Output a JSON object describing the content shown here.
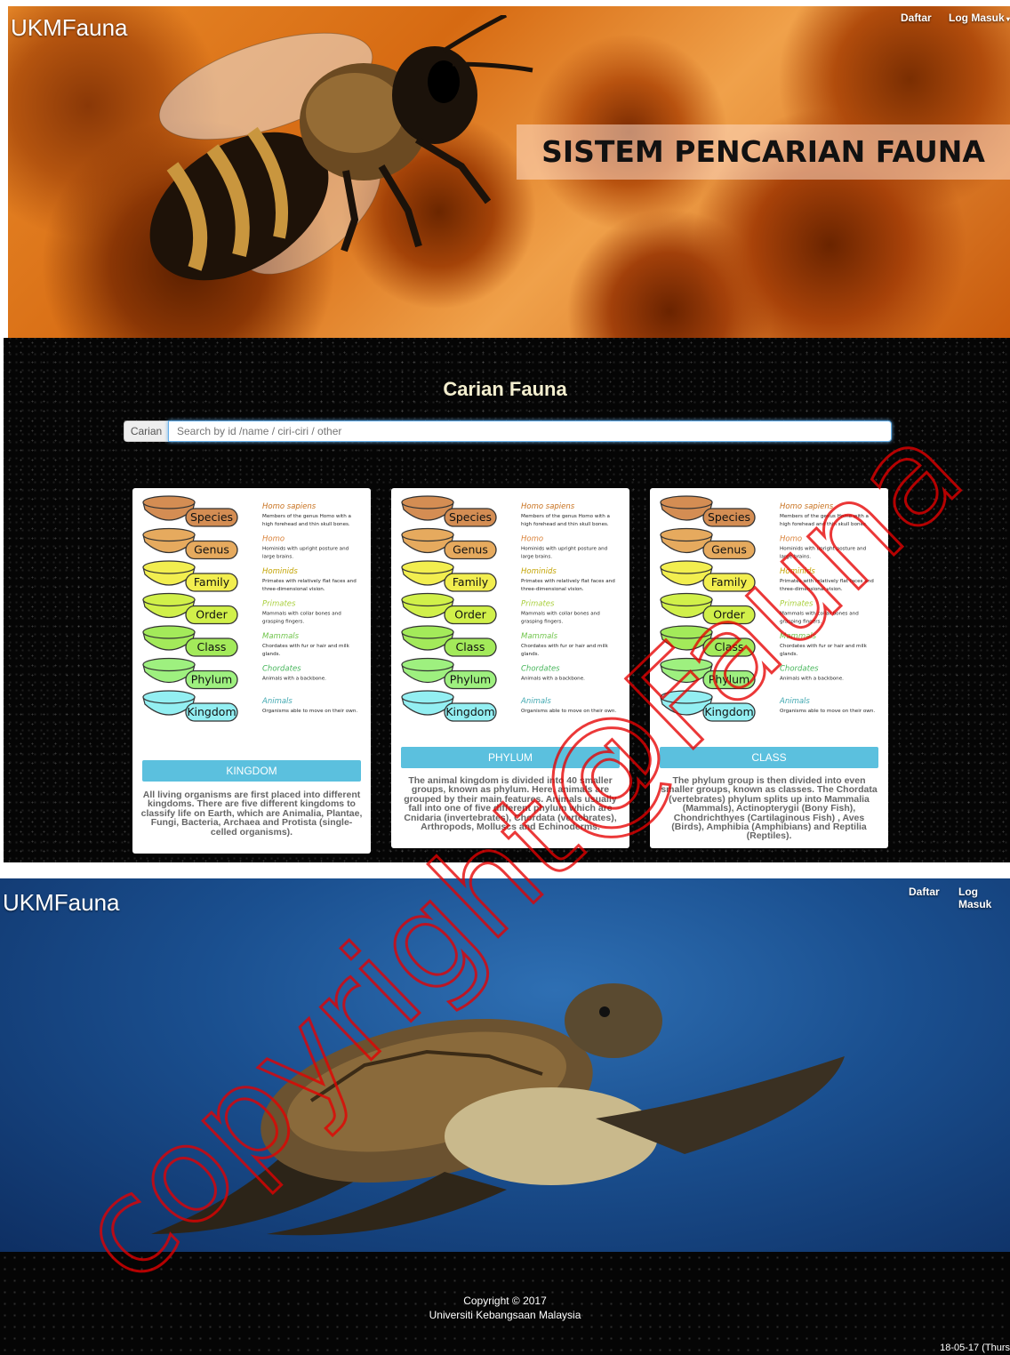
{
  "header1": {
    "brand": "UKMFauna",
    "nav_daftar": "Daftar",
    "nav_login": "Log Masuk",
    "banner": "SISTEM PENCARIAN FAUNA"
  },
  "search": {
    "title": "Carian Fauna",
    "addon": "Carian",
    "placeholder": "Search by id /name / ciri-ciri / other",
    "value": ""
  },
  "taxonomy": {
    "levels": [
      "Species",
      "Genus",
      "Family",
      "Order",
      "Class",
      "Phylum",
      "Kingdom"
    ],
    "colors": [
      "#d48d53",
      "#e6aa5e",
      "#f2ee4f",
      "#d1f04a",
      "#a3ea5a",
      "#9ef07f",
      "#93eff2"
    ],
    "examples": [
      {
        "name": "Homo sapiens",
        "desc1": "Members of the genus Homo with a",
        "desc2": "high forehead and thin skull bones.",
        "color": "#c8711e"
      },
      {
        "name": "Homo",
        "desc1": "Hominids with upright posture and",
        "desc2": "large brains.",
        "color": "#d9823a"
      },
      {
        "name": "Hominids",
        "desc1": "Primates with relatively flat faces and",
        "desc2": "three-dimensional vision.",
        "color": "#c3a300"
      },
      {
        "name": "Primates",
        "desc1": "Mammals with collar bones and",
        "desc2": "grasping fingers.",
        "color": "#a9cf3c"
      },
      {
        "name": "Mammals",
        "desc1": "Chordates with fur or hair and milk",
        "desc2": "glands.",
        "color": "#6fc44a"
      },
      {
        "name": "Chordates",
        "desc1": "Animals with a backbone.",
        "desc2": "",
        "color": "#48b65c"
      },
      {
        "name": "Animals",
        "desc1": "Organisms able to move on their own.",
        "desc2": "",
        "color": "#3fa7b0"
      }
    ]
  },
  "cards": [
    {
      "button": "KINGDOM",
      "text": "All living organisms are first placed into different kingdoms. There are five different kingdoms to classify life on Earth, which are Animalia, Plantae, Fungi, Bacteria, Archaea and Protista (single-celled organisms)."
    },
    {
      "button": "PHYLUM",
      "text": "The animal kingdom is divided into 40 smaller groups, known as phylum. Here, animals are grouped by their main features. Animals usually fall into one of five different phylum which are Cnidaria (invertebrates), Chordata (vertebrates), Arthropods, Molluscs and Echinoderms."
    },
    {
      "button": "CLASS",
      "text": "The phylum group is then divided into even smaller groups, known as classes. The Chordata (vertebrates) phylum splits up into Mammalia (Mammals), Actinopterygii (Bony Fish), Chondrichthyes (Cartilaginous Fish) , Aves (Birds), Amphibia (Amphibians) and Reptilia (Reptiles)."
    }
  ],
  "header2": {
    "brand": "UKMFauna",
    "nav_daftar": "Daftar",
    "nav_login": "Log Masuk"
  },
  "footer": {
    "copyright": "Copyright © 2017",
    "university": "Universiti Kebangsaan Malaysia",
    "date": "18-05-17 (Thurs"
  },
  "watermark": "copyright@Fauna"
}
